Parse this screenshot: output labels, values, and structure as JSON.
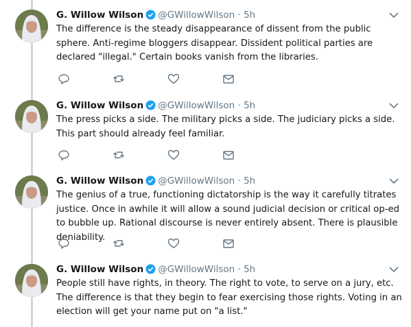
{
  "tweets": [
    {
      "name": "G. Willow Wilson",
      "handle": "@GWillowWilson",
      "time": "5h",
      "text": "The difference is the steady disappearance of dissent from the public sphere. Anti-regime bloggers disappear. Dissident political parties are declared \"illegal.\" Certain books vanish from the libraries."
    },
    {
      "name": "G. Willow Wilson",
      "handle": "@GWillowWilson",
      "time": "5h",
      "text": "The press picks a side. The military picks a side. The judiciary picks a side. This part should already feel familiar."
    },
    {
      "name": "G. Willow Wilson",
      "handle": "@GWillowWilson",
      "time": "5h",
      "text": "The genius of a true, functioning dictatorship is the way it carefully titrates justice. Once in awhile it will allow a sound judicial decision or critical op-ed to bubble up. Rational discourse is never entirely absent. There is plausible deniability."
    },
    {
      "name": "G. Willow Wilson",
      "handle": "@GWillowWilson",
      "time": "5h",
      "text": "People still have rights, in theory. The right to vote, to serve on a jury, etc. The difference is that they begin to fear exercising those rights. Voting in an election will get your name put on \"a list.\""
    }
  ],
  "separator": "·",
  "colors": {
    "text": "#14171a",
    "secondary": "#657786",
    "verified": "#1da1f2",
    "thread_line": "#ccd6dd"
  },
  "icons": [
    "reply-icon",
    "retweet-icon",
    "like-icon",
    "message-icon",
    "chevron-down-icon",
    "verified-icon"
  ]
}
